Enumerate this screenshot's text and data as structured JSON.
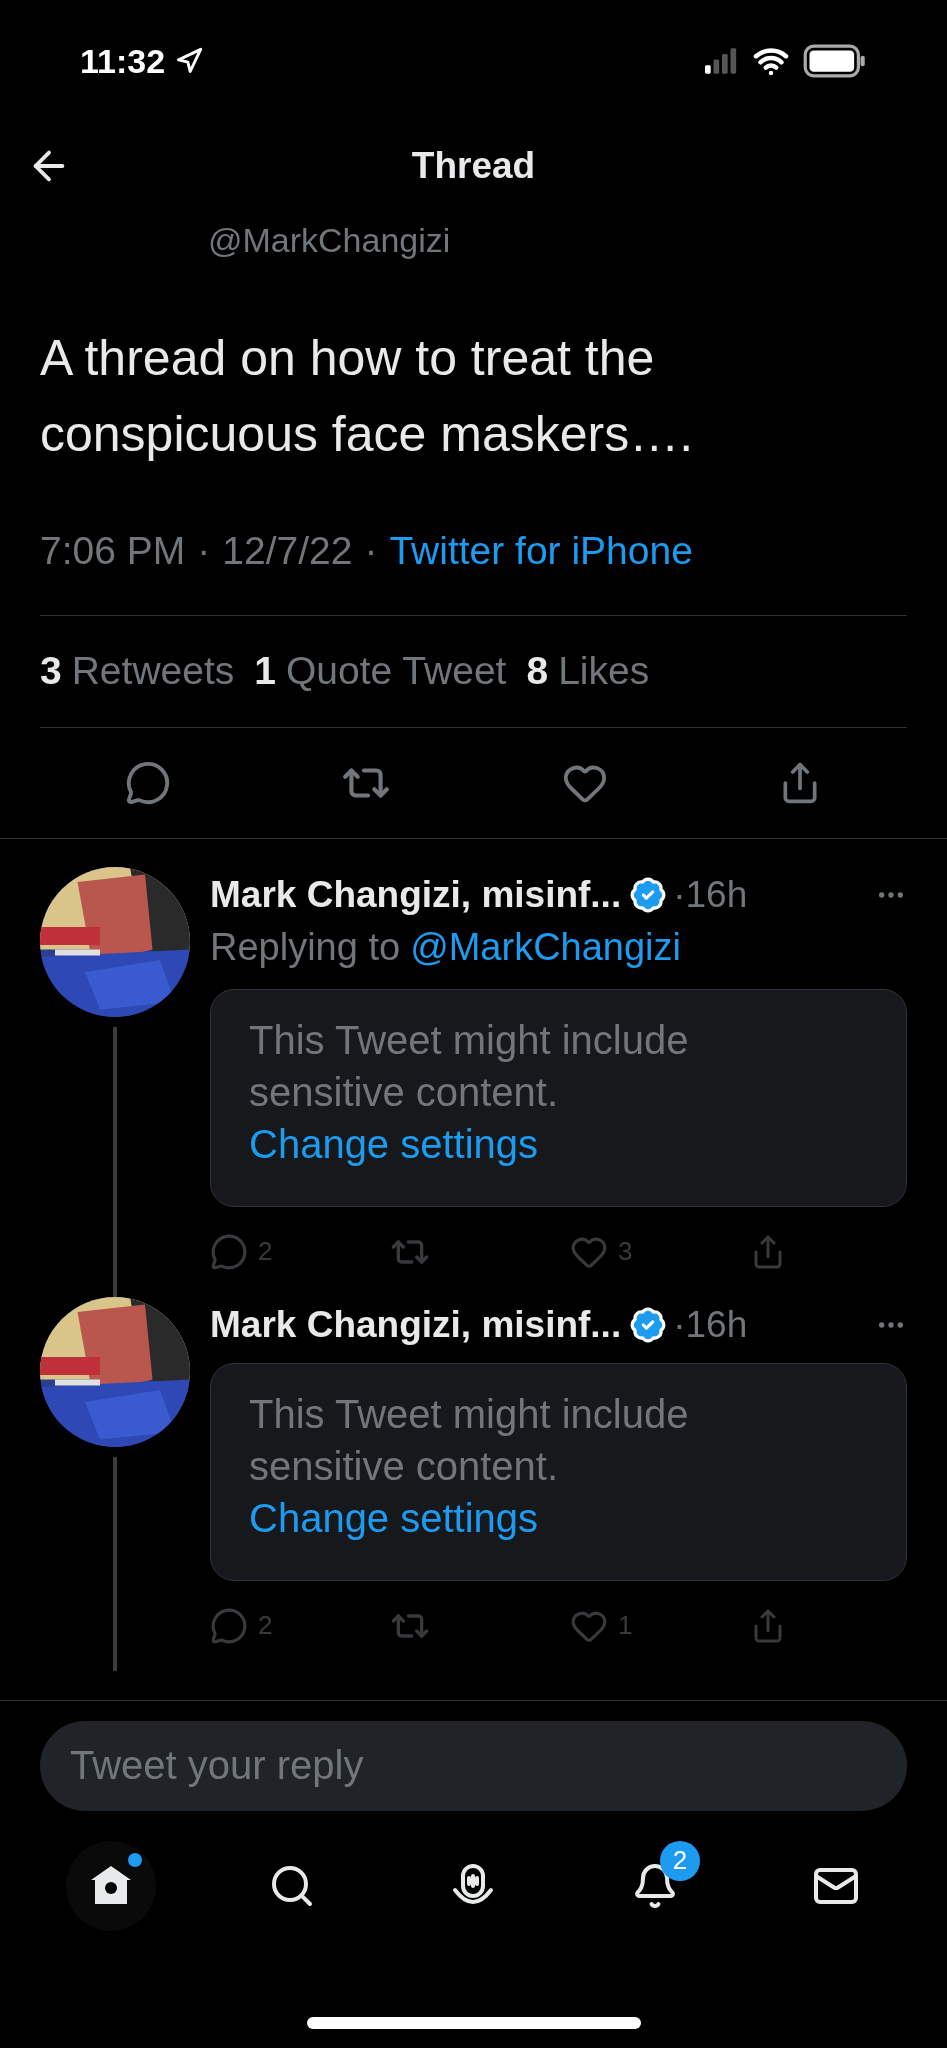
{
  "status_bar": {
    "time": "11:32"
  },
  "header": {
    "title": "Thread"
  },
  "tweet": {
    "handle": "@MarkChangizi",
    "text": "A thread on how to treat the conspicuous face maskers….",
    "time": "7:06 PM",
    "date": "12/7/22",
    "separator": "·",
    "source": "Twitter for iPhone"
  },
  "stats": [
    {
      "count": "3",
      "label": "Retweets"
    },
    {
      "count": "1",
      "label": "Quote Tweet"
    },
    {
      "count": "8",
      "label": "Likes"
    }
  ],
  "replies": [
    {
      "name": "Mark Changizi, misinf...",
      "verified": true,
      "time": "·16h",
      "replying_to": "Replying to",
      "replying_handle": "@MarkChangizi",
      "warning": "This Tweet might include sensitive content.",
      "link": "Change settings",
      "reply_count": "2",
      "like_count": "3"
    },
    {
      "name": "Mark Changizi, misinf...",
      "verified": true,
      "time": "·16h",
      "warning": "This Tweet might include sensitive content.",
      "link": "Change settings",
      "reply_count": "2",
      "like_count": "1"
    }
  ],
  "reply_field": {
    "placeholder": "Tweet your reply"
  },
  "nav": [
    {
      "kind": "home",
      "selected": true,
      "dot": true
    },
    {
      "kind": "search",
      "selected": false,
      "dot": false
    },
    {
      "kind": "spaces",
      "selected": false,
      "dot": false
    },
    {
      "kind": "notifications",
      "selected": false,
      "dot": false,
      "badge": "2"
    },
    {
      "kind": "messages",
      "selected": false,
      "dot": false
    }
  ]
}
